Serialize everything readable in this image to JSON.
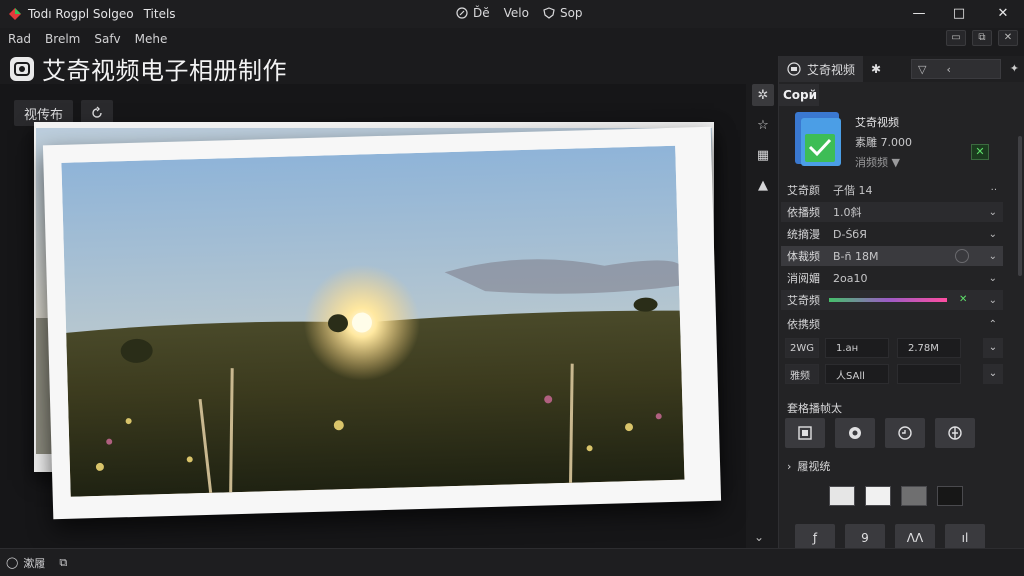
{
  "titlebar": {
    "title": "Todı Rogpl Solgeo",
    "subtitle": "Titels",
    "links": [
      {
        "icon": "pen-circle-icon",
        "label": "Ďĕ"
      },
      {
        "icon": "none",
        "label": "Velo"
      },
      {
        "icon": "shield-icon",
        "label": "Sop"
      }
    ],
    "controls": {
      "minimize": "—",
      "maximize": "□",
      "close": "✕"
    }
  },
  "menubar": {
    "items": [
      "Rad",
      "Brelm",
      "Safv",
      "Mehe"
    ]
  },
  "heading": {
    "icon": "album-logo-icon",
    "title": "艾奇视频电子相册制作"
  },
  "canvas": {
    "label": "视传布",
    "refresh_icon": "refresh-icon"
  },
  "right_panel": {
    "tab_label": "艾奇视频",
    "section_title": "Copй",
    "preset": {
      "name": "艾奇视频",
      "size": "素雕 7.000",
      "more": "消频频"
    },
    "props": [
      {
        "label": "艾奇颜",
        "value": "子偕 14"
      },
      {
        "label": "依播频",
        "value": "1.0斜"
      },
      {
        "label": "统摘漫",
        "value": "D-ŚбЯ"
      },
      {
        "label": "体裁频",
        "value": "B-ñ 18M"
      },
      {
        "label": "消阅媚",
        "value": "2oa10"
      },
      {
        "label": "艾奇频",
        "value": ""
      }
    ],
    "frame_label": "依携频",
    "frame_rows": [
      {
        "label": "2WG",
        "a": "1.aн",
        "b": "2.78M"
      },
      {
        "label": "雅频",
        "a": "人SAll",
        "b": ""
      }
    ],
    "effects_label": "套格播帧太",
    "swatch_label": "履视统",
    "swatch_colors": [
      "#e6e6e6",
      "#f1f1f1",
      "#6f6f70",
      "#171717"
    ],
    "bottom_buttons": [
      "ƒ",
      "9",
      "ΛΛ",
      "ıl"
    ]
  },
  "statusbar": {
    "items": [
      {
        "icon": "circle-icon",
        "label": "漱履"
      },
      {
        "icon": "export-icon",
        "label": ""
      }
    ]
  }
}
